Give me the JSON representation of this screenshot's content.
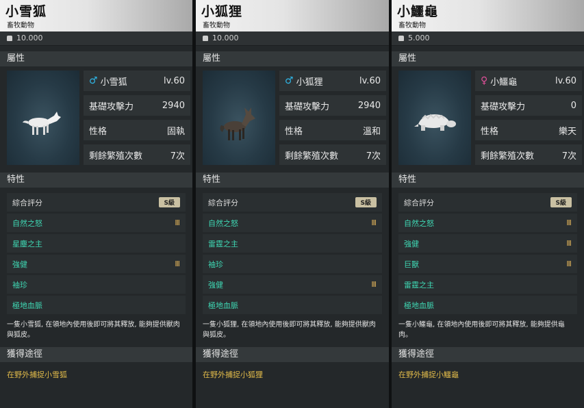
{
  "panels": [
    {
      "name": "小雪狐",
      "category": "畜牧動物",
      "weight": "10.000",
      "attr_label": "屬性",
      "gender": "male",
      "gender_symbol": "♂",
      "level": "lv.60",
      "atk_label": "基礎攻擊力",
      "atk": "2940",
      "nature_label": "性格",
      "nature": "固執",
      "breed_label": "剩餘繁殖次數",
      "breed": "7次",
      "traits_label": "特性",
      "score_label": "綜合評分",
      "score": "S級",
      "traits": [
        {
          "name": "自然之怒",
          "level": "Ⅲ"
        },
        {
          "name": "星塵之主",
          "level": ""
        },
        {
          "name": "強健",
          "level": "Ⅲ"
        },
        {
          "name": "袖珍",
          "level": ""
        },
        {
          "name": "極地血脈",
          "level": ""
        }
      ],
      "desc": "一隻小雪狐, 在領地內使用後即可將其釋放, 能夠提供獸肉與狐皮。",
      "source_label": "獲得途徑",
      "source": "在野外捕捉小雪狐"
    },
    {
      "name": "小狐狸",
      "category": "畜牧動物",
      "weight": "10.000",
      "attr_label": "屬性",
      "gender": "male",
      "gender_symbol": "♂",
      "level": "lv.60",
      "atk_label": "基礎攻擊力",
      "atk": "2940",
      "nature_label": "性格",
      "nature": "溫和",
      "breed_label": "剩餘繁殖次數",
      "breed": "7次",
      "traits_label": "特性",
      "score_label": "綜合評分",
      "score": "S級",
      "traits": [
        {
          "name": "自然之怒",
          "level": "Ⅲ"
        },
        {
          "name": "雷霆之主",
          "level": ""
        },
        {
          "name": "袖珍",
          "level": ""
        },
        {
          "name": "強健",
          "level": "Ⅲ"
        },
        {
          "name": "極地血脈",
          "level": ""
        }
      ],
      "desc": "一隻小狐狸, 在領地內使用後即可將其釋放, 能夠提供獸肉與狐皮。",
      "source_label": "獲得途徑",
      "source": "在野外捕捉小狐狸"
    },
    {
      "name": "小鱷龜",
      "category": "畜牧動物",
      "weight": "5.000",
      "attr_label": "屬性",
      "gender": "female",
      "gender_symbol": "♀",
      "level": "lv.60",
      "atk_label": "基礎攻擊力",
      "atk": "0",
      "nature_label": "性格",
      "nature": "樂天",
      "breed_label": "剩餘繁殖次數",
      "breed": "7次",
      "traits_label": "特性",
      "score_label": "綜合評分",
      "score": "S級",
      "traits": [
        {
          "name": "自然之怒",
          "level": "Ⅲ"
        },
        {
          "name": "強健",
          "level": "Ⅲ"
        },
        {
          "name": "巨獸",
          "level": "Ⅲ"
        },
        {
          "name": "雷霆之主",
          "level": ""
        },
        {
          "name": "極地血脈",
          "level": ""
        }
      ],
      "desc": "一隻小鱷龜, 在領地內使用後即可將其釋放, 能夠提供龜肉。",
      "source_label": "獲得途徑",
      "source": "在野外捕捉小鱷龜"
    }
  ]
}
